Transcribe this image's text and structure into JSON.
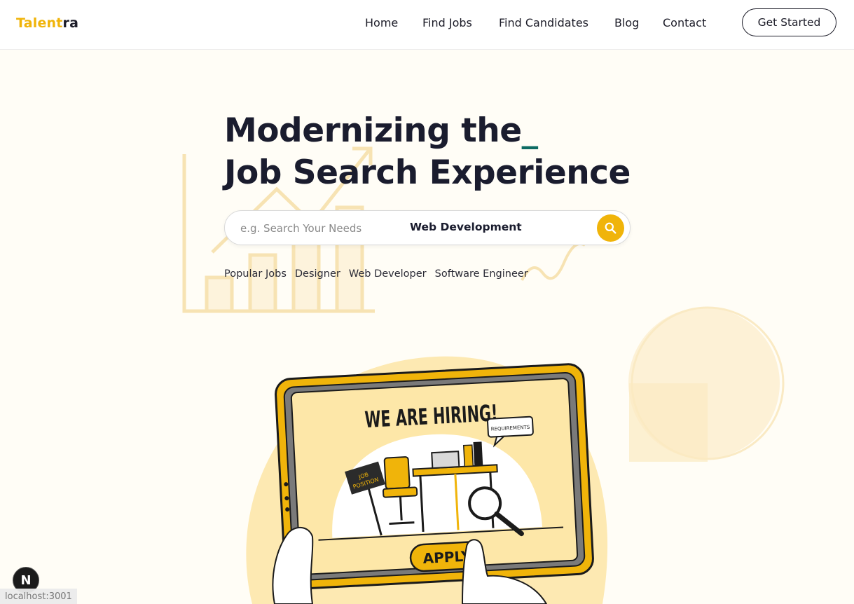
{
  "brand": {
    "part1": "Talent",
    "part2": "ra"
  },
  "nav": {
    "links": [
      "Home",
      "Find Jobs",
      "Find Candidates",
      "Blog",
      "Contact"
    ],
    "cta": "Get Started"
  },
  "hero": {
    "title_line1": "Modernizing the",
    "cursor": "_",
    "title_line2": "Job Search Experience"
  },
  "search": {
    "placeholder": "e.g. Search Your Needs",
    "value": "",
    "category": "Web Development"
  },
  "popular": {
    "label": "Popular Jobs",
    "tags": [
      "Designer",
      "Web Developer",
      "Software Engineer"
    ]
  },
  "illustration": {
    "headline": "WE ARE HIRING!",
    "bubble": "REQUIREMENTS",
    "sign": [
      "JOB",
      "POSITION"
    ],
    "button": "APPLY"
  },
  "dev": {
    "badge": "N",
    "url": "localhost:3001"
  },
  "colors": {
    "accent": "#f0b40a",
    "dark": "#1a1c2e",
    "cursor": "#0d6b63",
    "background": "#fffdf6"
  }
}
